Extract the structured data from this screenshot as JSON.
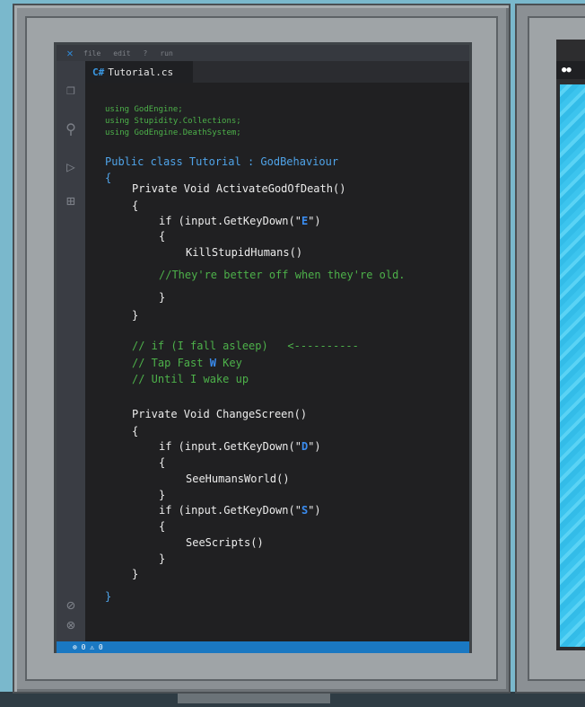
{
  "menu": [
    "file",
    "edit",
    "?",
    "run"
  ],
  "tab": {
    "icon": "C#",
    "name": "Tutorial.cs"
  },
  "code": {
    "using1": "using GodEngine;",
    "using2": "using Stupidity.Collections;",
    "using3": "using GodEngine.DeathSystem;",
    "class_line": "Public class Tutorial : GodBehaviour",
    "open1": "{",
    "method1": "Private Void ActivateGodOfDeath()",
    "open2": "{",
    "if1_pre": "if (input.GetKeyDown(\"",
    "if1_key": "E",
    "if1_post": "\")",
    "open3": "{",
    "call1": "KillStupidHumans()",
    "comment1": "//They're better off when they're old.",
    "close3": "}",
    "close2": "}",
    "comment2a": "// if (I fall asleep)   <----------",
    "comment2b_pre": "// Tap Fast ",
    "comment2b_key": "W",
    "comment2b_post": " Key",
    "comment2c": "// Until I wake up",
    "method2": "Private Void ChangeScreen()",
    "open4": "{",
    "if2_pre": "if (input.GetKeyDown(\"",
    "if2_key": "D",
    "if2_post": "\")",
    "open5": "{",
    "call2": "SeeHumansWorld()",
    "close5": "}",
    "if3_pre": "if (input.GetKeyDown(\"",
    "if3_key": "S",
    "if3_post": "\")",
    "open6": "{",
    "call3": "SeeScripts()",
    "close6": "}",
    "close4": "}",
    "close1": "}"
  },
  "status_bar": "⊗ 0  ⚠ 0",
  "second_screen_tab": "●●"
}
